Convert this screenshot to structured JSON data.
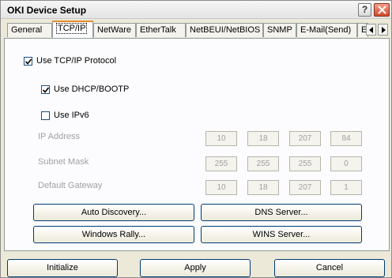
{
  "window": {
    "title": "OKI Device Setup",
    "help_label": "?"
  },
  "tabs": [
    {
      "label": "General"
    },
    {
      "label": "TCP/IP"
    },
    {
      "label": "NetWare"
    },
    {
      "label": "EtherTalk"
    },
    {
      "label": "NetBEUI/NetBIOS"
    },
    {
      "label": "SNMP"
    },
    {
      "label": "E-Mail(Send)"
    },
    {
      "label": "E-M"
    }
  ],
  "active_tab": "TCP/IP",
  "options": {
    "use_tcpip": {
      "label": "Use TCP/IP Protocol",
      "checked": true
    },
    "use_dhcp": {
      "label": "Use DHCP/BOOTP",
      "checked": true
    },
    "use_ipv6": {
      "label": "Use IPv6",
      "checked": false
    }
  },
  "fields": {
    "ip_address": {
      "label": "IP Address",
      "octets": [
        "10",
        "18",
        "207",
        "84"
      ]
    },
    "subnet_mask": {
      "label": "Subnet Mask",
      "octets": [
        "255",
        "255",
        "255",
        "0"
      ]
    },
    "default_gateway": {
      "label": "Default Gateway",
      "octets": [
        "10",
        "18",
        "207",
        "1"
      ]
    }
  },
  "buttons": {
    "auto_discovery": "Auto Discovery...",
    "dns_server": "DNS Server...",
    "windows_rally": "Windows Rally...",
    "wins_server": "WINS Server...",
    "initialize": "Initialize",
    "apply": "Apply",
    "cancel": "Cancel"
  },
  "colors": {
    "dialog_bg": "#ece9d8",
    "panel_bg": "#fcfcfe",
    "active_tab_accent": "#e68b2c",
    "disabled_text": "#a0a0a0"
  }
}
